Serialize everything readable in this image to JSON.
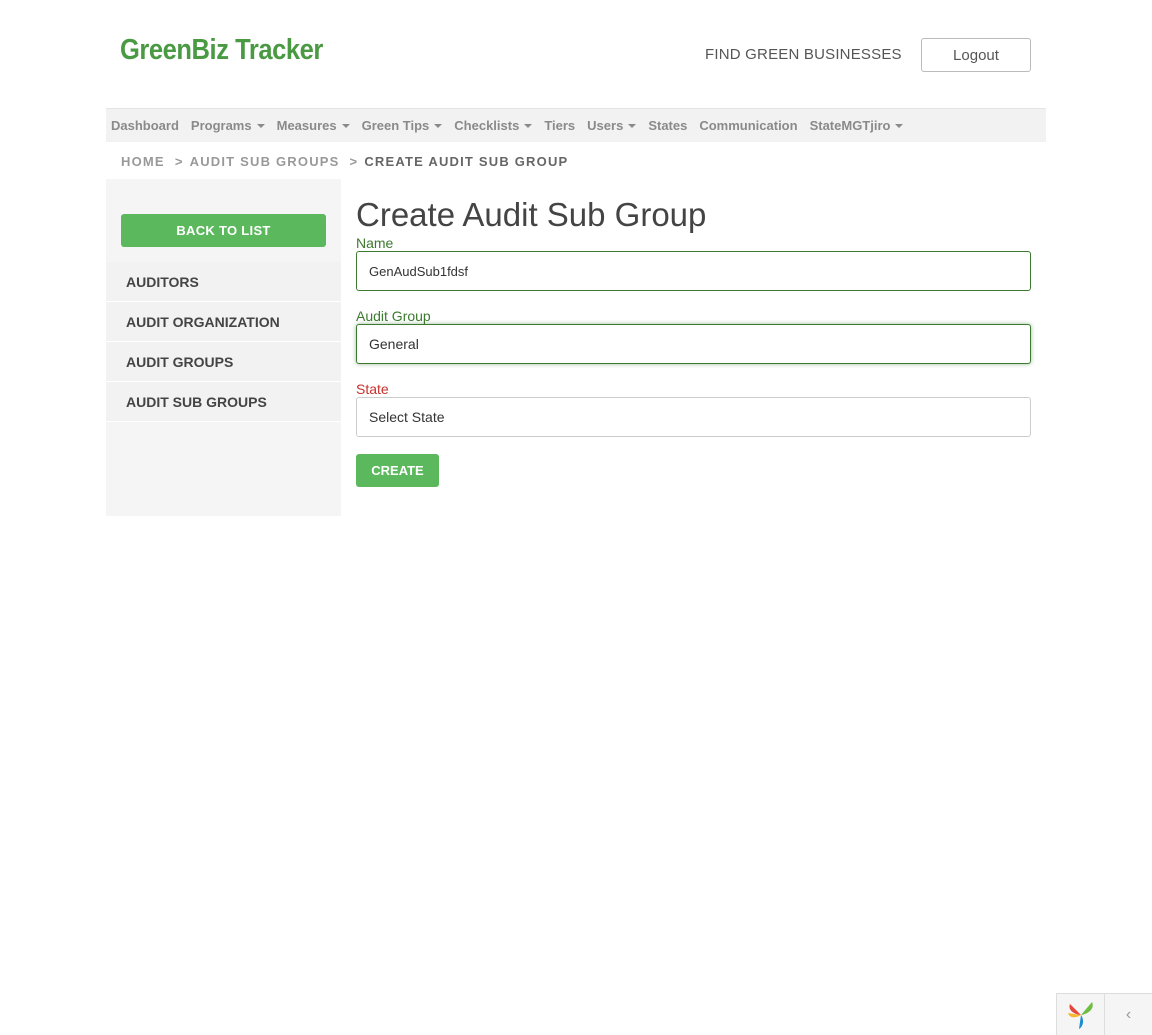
{
  "header": {
    "logo": "GreenBiz Tracker",
    "find_link": "FIND GREEN BUSINESSES",
    "logout_label": "Logout"
  },
  "nav": {
    "items": [
      {
        "label": "Dashboard",
        "dropdown": false
      },
      {
        "label": "Programs",
        "dropdown": true
      },
      {
        "label": "Measures",
        "dropdown": true
      },
      {
        "label": "Green Tips",
        "dropdown": true
      },
      {
        "label": "Checklists",
        "dropdown": true
      },
      {
        "label": "Tiers",
        "dropdown": false
      },
      {
        "label": "Users",
        "dropdown": true
      },
      {
        "label": "States",
        "dropdown": false
      },
      {
        "label": "Communication",
        "dropdown": false
      },
      {
        "label": "StateMGTjiro",
        "dropdown": true
      }
    ]
  },
  "breadcrumb": {
    "home": "HOME",
    "sep1": ">",
    "parent": "AUDIT SUB GROUPS",
    "sep2": ">",
    "current": "CREATE AUDIT SUB GROUP"
  },
  "sidebar": {
    "back_label": "BACK TO LIST",
    "items": [
      {
        "label": "AUDITORS"
      },
      {
        "label": "AUDIT ORGANIZATION"
      },
      {
        "label": "AUDIT GROUPS"
      },
      {
        "label": "AUDIT SUB GROUPS"
      }
    ]
  },
  "form": {
    "title": "Create Audit Sub Group",
    "name_label": "Name",
    "name_value": "GenAudSub1fdsf",
    "audit_group_label": "Audit Group",
    "audit_group_value": "General",
    "state_label": "State",
    "state_value": "Select State",
    "submit_label": "CREATE"
  },
  "colors": {
    "brand_green": "#4a9a44",
    "button_green": "#5cb85c",
    "label_green": "#3c7a2f",
    "error_red": "#c9302c"
  },
  "toolbar": {
    "logo_icon": "yii-logo-icon",
    "toggle_icon": "chevron-left-icon",
    "toggle_glyph": "‹"
  }
}
